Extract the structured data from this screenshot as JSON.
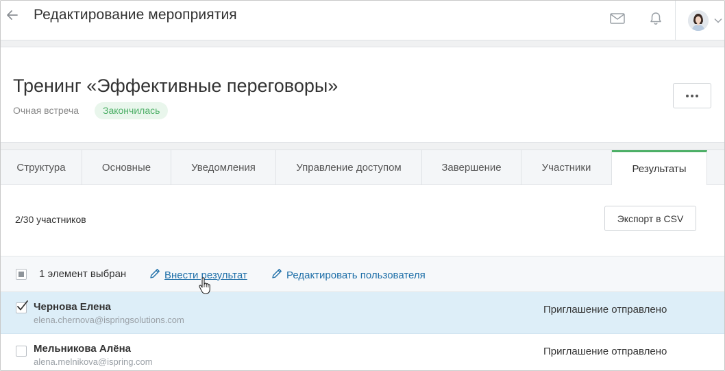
{
  "header": {
    "title": "Редактирование мероприятия",
    "back_icon": "arrow-left-icon",
    "mail_icon": "envelope-icon",
    "bell_icon": "bell-icon"
  },
  "event": {
    "title": "Тренинг «Эффективные переговоры»",
    "type": "Очная встреча",
    "status": "Закончилась",
    "status_color": "#4caf66"
  },
  "tabs": [
    {
      "label": "Структура",
      "active": false
    },
    {
      "label": "Основные",
      "active": false
    },
    {
      "label": "Уведомления",
      "active": false
    },
    {
      "label": "Управление доступом",
      "active": false
    },
    {
      "label": "Завершение",
      "active": false
    },
    {
      "label": "Участники",
      "active": false
    },
    {
      "label": "Результаты",
      "active": true
    }
  ],
  "results": {
    "count": "2/30 участников",
    "export_label": "Экспорт в CSV"
  },
  "selection": {
    "text": "1 элемент выбран",
    "action_result": "Внести результат",
    "action_edit_user": "Редактировать пользователя",
    "link_color": "#1e6fa8"
  },
  "participants": [
    {
      "name": "Чернова Елена",
      "email": "elena.chernova@ispringsolutions.com",
      "status": "Приглашение отправлено",
      "checked": true
    },
    {
      "name": "Мельникова Алёна",
      "email": "alena.melnikova@ispring.com",
      "status": "Приглашение отправлено",
      "checked": false
    }
  ]
}
